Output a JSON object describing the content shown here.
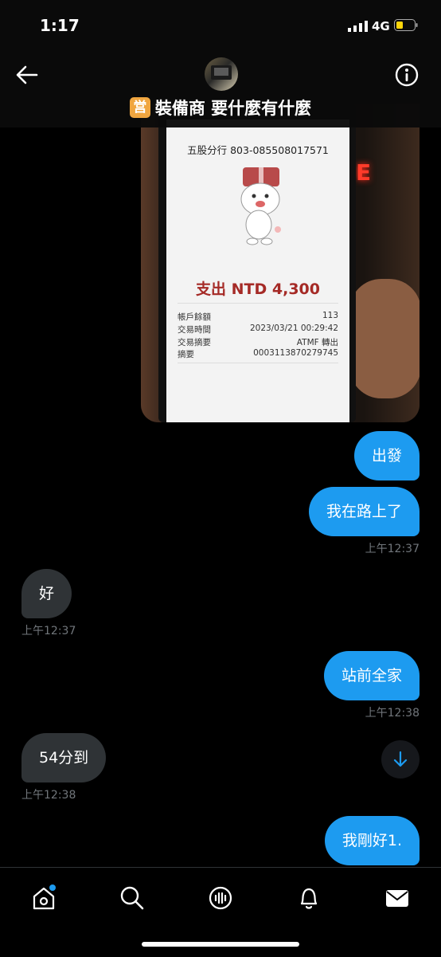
{
  "status": {
    "time": "1:17",
    "network": "4G"
  },
  "header": {
    "badge": "営",
    "title": "裝備商 要什麼有什麼"
  },
  "receipt": {
    "account": "五股分行 803-085508017571",
    "amount": "支出 NTD 4,300",
    "rows": [
      {
        "label": "帳戶餘額",
        "value": "113"
      },
      {
        "label": "交易時間",
        "value": "2023/03/21 00:29:42"
      },
      {
        "label": "交易摘要",
        "value": "ATMF 轉出"
      },
      {
        "label": "摘要",
        "value": "0003113870279745"
      }
    ],
    "neon": "E"
  },
  "messages": [
    {
      "text": "出發",
      "dir": "out"
    },
    {
      "text": "我在路上了",
      "dir": "out",
      "time": "上午12:37"
    },
    {
      "text": "好",
      "dir": "in",
      "time": "上午12:37"
    },
    {
      "text": "站前全家",
      "dir": "out",
      "time": "上午12:38"
    },
    {
      "text": "54分到",
      "dir": "in",
      "time": "上午12:38"
    },
    {
      "text": "我剛好1.",
      "dir": "out"
    }
  ],
  "colors": {
    "accent": "#1d9bf0",
    "incoming": "#2f3336",
    "badge": "#f0a640"
  },
  "icons": [
    "back-arrow-icon",
    "info-icon",
    "scroll-down-icon",
    "home-icon",
    "search-icon",
    "spaces-icon",
    "notifications-icon",
    "messages-icon"
  ]
}
